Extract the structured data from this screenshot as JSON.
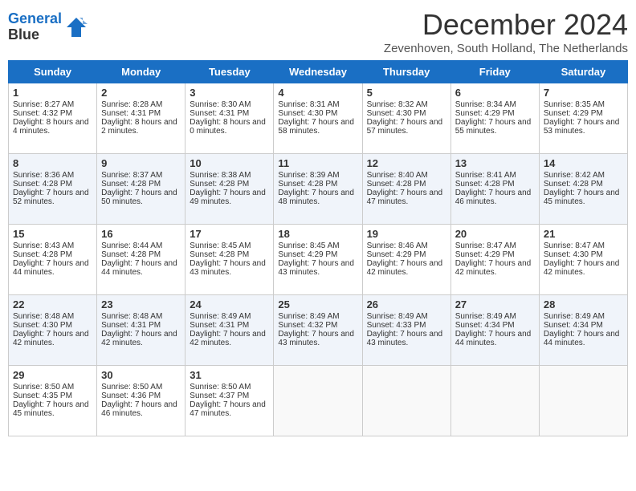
{
  "logo": {
    "line1": "General",
    "line2": "Blue"
  },
  "title": "December 2024",
  "subtitle": "Zevenhoven, South Holland, The Netherlands",
  "days_of_week": [
    "Sunday",
    "Monday",
    "Tuesday",
    "Wednesday",
    "Thursday",
    "Friday",
    "Saturday"
  ],
  "weeks": [
    [
      {
        "day": 1,
        "sunrise": "8:27 AM",
        "sunset": "4:32 PM",
        "daylight": "8 hours and 4 minutes."
      },
      {
        "day": 2,
        "sunrise": "8:28 AM",
        "sunset": "4:31 PM",
        "daylight": "8 hours and 2 minutes."
      },
      {
        "day": 3,
        "sunrise": "8:30 AM",
        "sunset": "4:31 PM",
        "daylight": "8 hours and 0 minutes."
      },
      {
        "day": 4,
        "sunrise": "8:31 AM",
        "sunset": "4:30 PM",
        "daylight": "7 hours and 58 minutes."
      },
      {
        "day": 5,
        "sunrise": "8:32 AM",
        "sunset": "4:30 PM",
        "daylight": "7 hours and 57 minutes."
      },
      {
        "day": 6,
        "sunrise": "8:34 AM",
        "sunset": "4:29 PM",
        "daylight": "7 hours and 55 minutes."
      },
      {
        "day": 7,
        "sunrise": "8:35 AM",
        "sunset": "4:29 PM",
        "daylight": "7 hours and 53 minutes."
      }
    ],
    [
      {
        "day": 8,
        "sunrise": "8:36 AM",
        "sunset": "4:28 PM",
        "daylight": "7 hours and 52 minutes."
      },
      {
        "day": 9,
        "sunrise": "8:37 AM",
        "sunset": "4:28 PM",
        "daylight": "7 hours and 50 minutes."
      },
      {
        "day": 10,
        "sunrise": "8:38 AM",
        "sunset": "4:28 PM",
        "daylight": "7 hours and 49 minutes."
      },
      {
        "day": 11,
        "sunrise": "8:39 AM",
        "sunset": "4:28 PM",
        "daylight": "7 hours and 48 minutes."
      },
      {
        "day": 12,
        "sunrise": "8:40 AM",
        "sunset": "4:28 PM",
        "daylight": "7 hours and 47 minutes."
      },
      {
        "day": 13,
        "sunrise": "8:41 AM",
        "sunset": "4:28 PM",
        "daylight": "7 hours and 46 minutes."
      },
      {
        "day": 14,
        "sunrise": "8:42 AM",
        "sunset": "4:28 PM",
        "daylight": "7 hours and 45 minutes."
      }
    ],
    [
      {
        "day": 15,
        "sunrise": "8:43 AM",
        "sunset": "4:28 PM",
        "daylight": "7 hours and 44 minutes."
      },
      {
        "day": 16,
        "sunrise": "8:44 AM",
        "sunset": "4:28 PM",
        "daylight": "7 hours and 44 minutes."
      },
      {
        "day": 17,
        "sunrise": "8:45 AM",
        "sunset": "4:28 PM",
        "daylight": "7 hours and 43 minutes."
      },
      {
        "day": 18,
        "sunrise": "8:45 AM",
        "sunset": "4:29 PM",
        "daylight": "7 hours and 43 minutes."
      },
      {
        "day": 19,
        "sunrise": "8:46 AM",
        "sunset": "4:29 PM",
        "daylight": "7 hours and 42 minutes."
      },
      {
        "day": 20,
        "sunrise": "8:47 AM",
        "sunset": "4:29 PM",
        "daylight": "7 hours and 42 minutes."
      },
      {
        "day": 21,
        "sunrise": "8:47 AM",
        "sunset": "4:30 PM",
        "daylight": "7 hours and 42 minutes."
      }
    ],
    [
      {
        "day": 22,
        "sunrise": "8:48 AM",
        "sunset": "4:30 PM",
        "daylight": "7 hours and 42 minutes."
      },
      {
        "day": 23,
        "sunrise": "8:48 AM",
        "sunset": "4:31 PM",
        "daylight": "7 hours and 42 minutes."
      },
      {
        "day": 24,
        "sunrise": "8:49 AM",
        "sunset": "4:31 PM",
        "daylight": "7 hours and 42 minutes."
      },
      {
        "day": 25,
        "sunrise": "8:49 AM",
        "sunset": "4:32 PM",
        "daylight": "7 hours and 43 minutes."
      },
      {
        "day": 26,
        "sunrise": "8:49 AM",
        "sunset": "4:33 PM",
        "daylight": "7 hours and 43 minutes."
      },
      {
        "day": 27,
        "sunrise": "8:49 AM",
        "sunset": "4:34 PM",
        "daylight": "7 hours and 44 minutes."
      },
      {
        "day": 28,
        "sunrise": "8:49 AM",
        "sunset": "4:34 PM",
        "daylight": "7 hours and 44 minutes."
      }
    ],
    [
      {
        "day": 29,
        "sunrise": "8:50 AM",
        "sunset": "4:35 PM",
        "daylight": "7 hours and 45 minutes."
      },
      {
        "day": 30,
        "sunrise": "8:50 AM",
        "sunset": "4:36 PM",
        "daylight": "7 hours and 46 minutes."
      },
      {
        "day": 31,
        "sunrise": "8:50 AM",
        "sunset": "4:37 PM",
        "daylight": "7 hours and 47 minutes."
      },
      null,
      null,
      null,
      null
    ]
  ]
}
